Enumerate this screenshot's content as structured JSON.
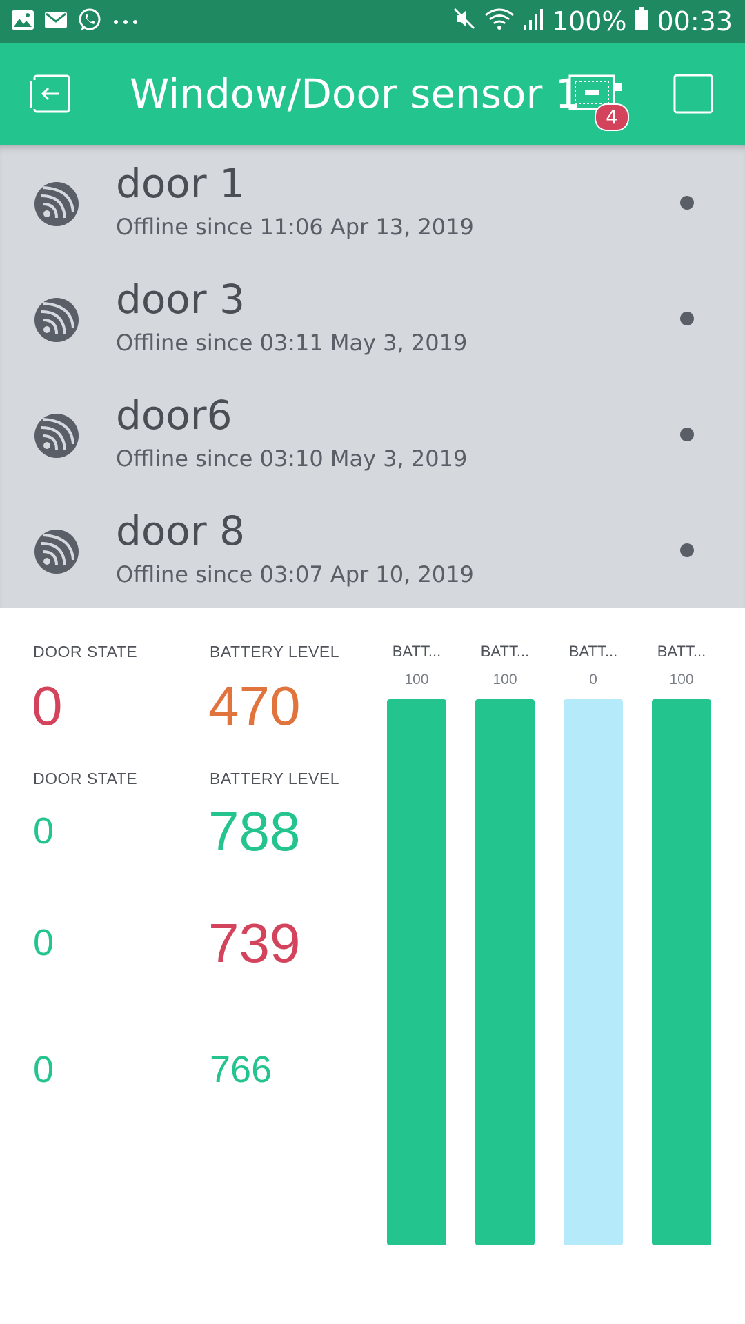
{
  "status_bar": {
    "battery_percent": "100%",
    "time": "00:33",
    "left_icons": [
      "image-icon",
      "mail-icon",
      "whatsapp-icon",
      "more-dots-icon"
    ],
    "right_icons": [
      "mute-icon",
      "wifi-icon",
      "signal-icon",
      "battery-icon"
    ]
  },
  "app_bar": {
    "title": "Window/Door sensor 1",
    "device_badge": "4",
    "color": "#23c48e"
  },
  "devices": [
    {
      "name": "door 1",
      "status": "Offline since 11:06 Apr 13, 2019"
    },
    {
      "name": "door 3",
      "status": "Offline since 03:11 May 3, 2019"
    },
    {
      "name": "door6",
      "status": "Offline since 03:10 May 3, 2019"
    },
    {
      "name": "door 8",
      "status": "Offline since 03:07 Apr 10, 2019"
    }
  ],
  "dashboard": {
    "door_state_label_1": "DOOR STATE",
    "battery_level_label_1": "BATTERY LEVEL",
    "door_state_label_2": "DOOR STATE",
    "battery_level_label_2": "BATTERY LEVEL",
    "rows": [
      {
        "door_state": "0",
        "battery": "470",
        "door_color": "#d3435c",
        "battery_color": "#e0743c"
      },
      {
        "door_state": "0",
        "battery": "788",
        "door_color": "#23c48e",
        "battery_color": "#23c48e"
      },
      {
        "door_state": "0",
        "battery": "739",
        "door_color": "#23c48e",
        "battery_color": "#d3435c"
      },
      {
        "door_state": "0",
        "battery": "766",
        "door_color": "#23c48e",
        "battery_color": "#23c48e"
      }
    ],
    "bars": [
      {
        "label": "BATT...",
        "max": "100",
        "level": 1.0
      },
      {
        "label": "BATT...",
        "max": "100",
        "level": 1.0
      },
      {
        "label": "BATT...",
        "max": "0",
        "level": 0.0
      },
      {
        "label": "BATT...",
        "max": "100",
        "level": 1.0
      }
    ]
  }
}
